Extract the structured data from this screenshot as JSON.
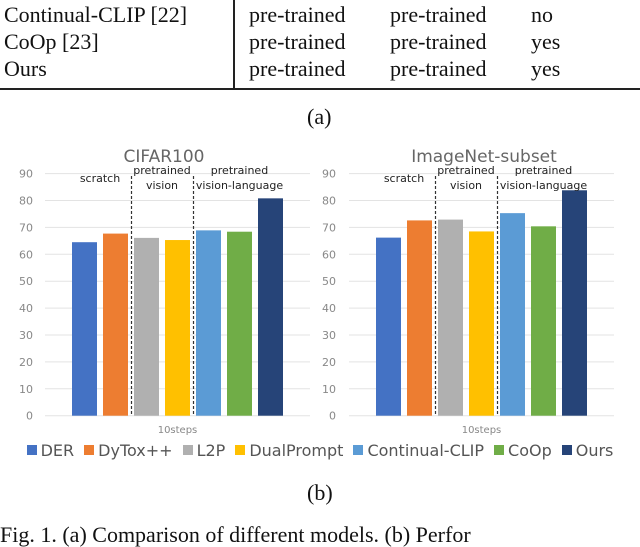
{
  "table": {
    "rows": [
      {
        "method": "Continual-CLIP [22]",
        "col1": "pre-trained",
        "col2": "pre-trained",
        "col3": "no"
      },
      {
        "method": "CoOp [23]",
        "col1": "pre-trained",
        "col2": "pre-trained",
        "col3": "yes"
      },
      {
        "method": "Ours",
        "col1": "pre-trained",
        "col2": "pre-trained",
        "col3": "yes"
      }
    ],
    "caption": "(a)"
  },
  "figure_b_caption": "(b)",
  "figure_caption": "Fig. 1. (a) Comparison of different models. (b) Perfor",
  "chart_data": [
    {
      "type": "bar",
      "title": "CIFAR100",
      "xlabel": "10steps",
      "ylabel": "",
      "ylim": [
        0,
        90
      ],
      "yticks": [
        0,
        10,
        20,
        30,
        40,
        50,
        60,
        70,
        80,
        90
      ],
      "grid": true,
      "categories": [
        "10steps"
      ],
      "groups": [
        {
          "label": [
            "scratch"
          ],
          "members": [
            "DER",
            "DyTox++"
          ]
        },
        {
          "label": [
            "pretrained",
            "vision"
          ],
          "members": [
            "L2P",
            "DualPrompt"
          ]
        },
        {
          "label": [
            "pretrained",
            "vision-language"
          ],
          "members": [
            "Continual-CLIP",
            "CoOp",
            "Ours"
          ]
        }
      ],
      "series": [
        {
          "name": "DER",
          "values": [
            64.5
          ],
          "color": "#4472C4"
        },
        {
          "name": "DyTox++",
          "values": [
            67.7
          ],
          "color": "#ED7D31"
        },
        {
          "name": "L2P",
          "values": [
            66.1
          ],
          "color": "#B0B0B0"
        },
        {
          "name": "DualPrompt",
          "values": [
            65.3
          ],
          "color": "#FFC000"
        },
        {
          "name": "Continual-CLIP",
          "values": [
            68.9
          ],
          "color": "#5B9BD5"
        },
        {
          "name": "CoOp",
          "values": [
            68.4
          ],
          "color": "#70AD47"
        },
        {
          "name": "Ours",
          "values": [
            80.8
          ],
          "color": "#264478"
        }
      ]
    },
    {
      "type": "bar",
      "title": "ImageNet-subset",
      "xlabel": "10steps",
      "ylabel": "",
      "ylim": [
        0,
        90
      ],
      "yticks": [
        0,
        10,
        20,
        30,
        40,
        50,
        60,
        70,
        80,
        90
      ],
      "grid": true,
      "categories": [
        "10steps"
      ],
      "groups": [
        {
          "label": [
            "scratch"
          ],
          "members": [
            "DER",
            "DyTox++"
          ]
        },
        {
          "label": [
            "pretrained",
            "vision"
          ],
          "members": [
            "L2P",
            "DualPrompt"
          ]
        },
        {
          "label": [
            "pretrained",
            "vision-language"
          ],
          "members": [
            "Continual-CLIP",
            "CoOp",
            "Ours"
          ]
        }
      ],
      "series": [
        {
          "name": "DER",
          "values": [
            66.2
          ],
          "color": "#4472C4"
        },
        {
          "name": "DyTox++",
          "values": [
            72.6
          ],
          "color": "#ED7D31"
        },
        {
          "name": "L2P",
          "values": [
            72.9
          ],
          "color": "#B0B0B0"
        },
        {
          "name": "DualPrompt",
          "values": [
            68.5
          ],
          "color": "#FFC000"
        },
        {
          "name": "Continual-CLIP",
          "values": [
            75.3
          ],
          "color": "#5B9BD5"
        },
        {
          "name": "CoOp",
          "values": [
            70.4
          ],
          "color": "#70AD47"
        },
        {
          "name": "Ours",
          "values": [
            83.8
          ],
          "color": "#264478"
        }
      ]
    }
  ],
  "legend": {
    "position": "bottom",
    "items": [
      {
        "name": "DER",
        "color": "#4472C4"
      },
      {
        "name": "DyTox++",
        "color": "#ED7D31"
      },
      {
        "name": "L2P",
        "color": "#B0B0B0"
      },
      {
        "name": "DualPrompt",
        "color": "#FFC000"
      },
      {
        "name": "Continual-CLIP",
        "color": "#5B9BD5"
      },
      {
        "name": "CoOp",
        "color": "#70AD47"
      },
      {
        "name": "Ours",
        "color": "#264478"
      }
    ]
  }
}
